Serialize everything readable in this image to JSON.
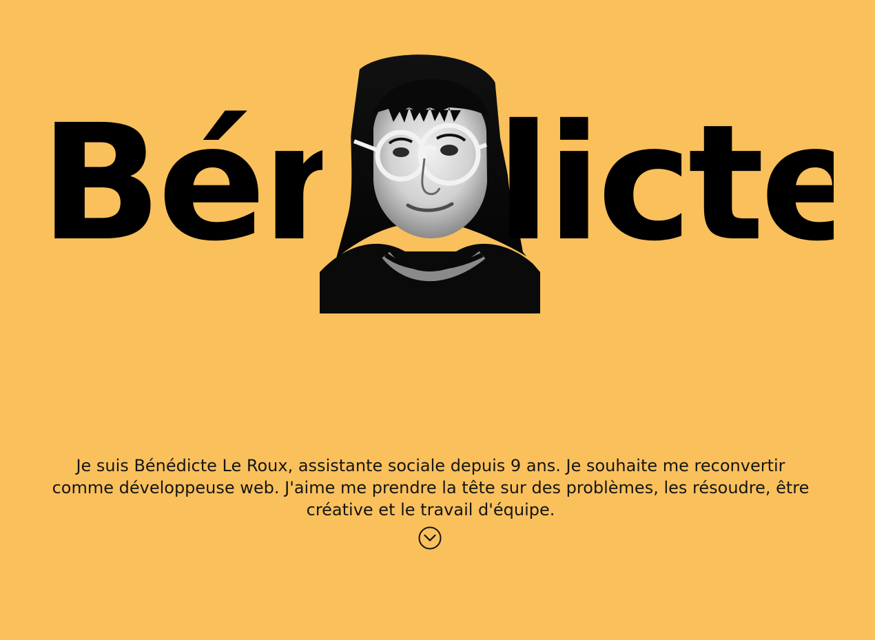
{
  "hero": {
    "name_left": "Bén",
    "name_right": "licte",
    "portrait_label": "Portrait of Bénédicte"
  },
  "bio": {
    "text": "Je suis Bénédicte Le Roux, assistante sociale depuis 9 ans. Je souhaite me reconvertir comme développeuse web. J'aime me prendre la tête sur des problèmes, les résoudre, être créative et le travail d'équipe."
  },
  "scroll_down": {
    "icon": "chevron-down-circle-icon"
  },
  "colors": {
    "background": "#f9c05c",
    "text": "#111111",
    "title": "#000000"
  }
}
